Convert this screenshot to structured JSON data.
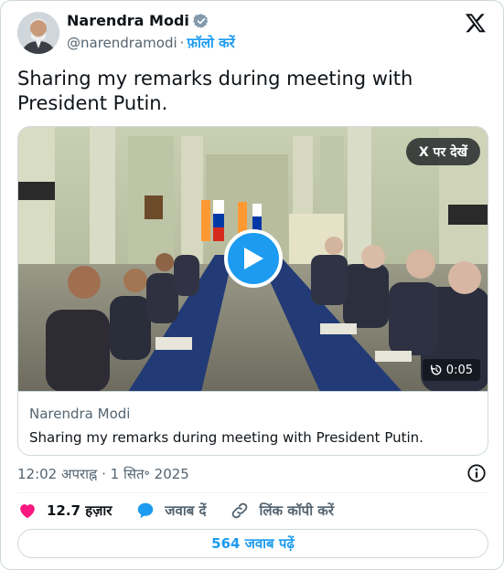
{
  "author": {
    "display_name": "Narendra Modi",
    "handle": "@narendramodi",
    "separator": "·",
    "follow_label": "फ़ॉलो करें"
  },
  "icons": {
    "verified": "verified-badge-icon",
    "brand": "x-logo-icon",
    "play": "play-icon",
    "replay": "replay-icon",
    "info": "info-icon",
    "like": "heart-icon",
    "reply": "speech-bubble-icon",
    "copy_link": "link-icon"
  },
  "tweet": {
    "text": "Sharing my remarks during meeting with President Putin."
  },
  "media": {
    "view_on_x_label": "X पर देखें",
    "duration": "0:05",
    "card_author": "Narendra Modi",
    "card_title": "Sharing my remarks during meeting with President Putin."
  },
  "footer": {
    "timestamp": "12:02 अपराह्न · 1 सित॰ 2025",
    "like_count": "12.7 हज़ार",
    "reply_label": "जवाब दें",
    "copy_link_label": "लिंक कॉपी करें",
    "read_replies_label": "564 जवाब पढ़ें"
  },
  "colors": {
    "accent": "#1d9bf0",
    "like": "#f91880",
    "muted": "#536471",
    "text": "#0f1419",
    "border": "#cfd9de"
  }
}
